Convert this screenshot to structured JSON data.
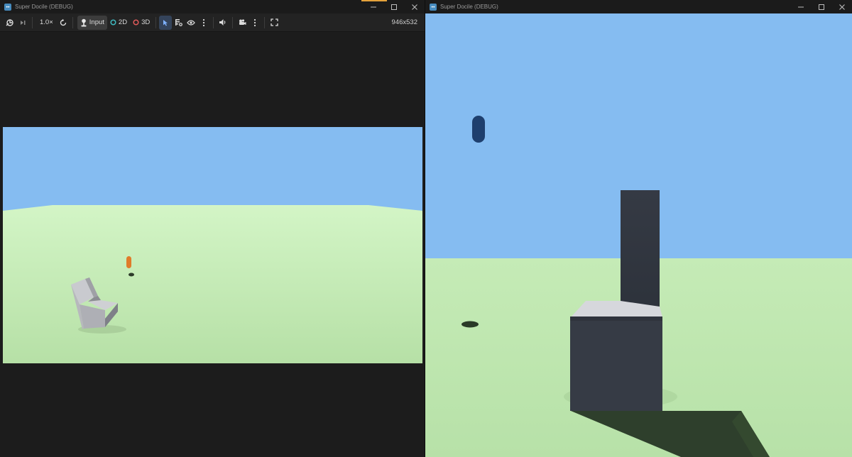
{
  "left_window": {
    "title": "Super Docile (DEBUG)",
    "toolbar": {
      "speed": "1.0×",
      "input_label": "Input",
      "mode_2d": "2D",
      "mode_3d": "3D",
      "resolution": "946x532"
    }
  },
  "right_window": {
    "title": "Super Docile (DEBUG)"
  },
  "colors": {
    "sky": "#85bcf1",
    "ground": "#c3eab6",
    "panel": "#1c1c1c",
    "player_capsule": "#e07b2a",
    "enemy_capsule": "#1e3f6e",
    "dark_block": "#363b45",
    "gray_block": "#b7b8bd",
    "accent": "#478cbf",
    "icon_2d": "#3fb9bf",
    "icon_3d": "#e05a5a"
  },
  "icons": [
    "godot-icon",
    "minimize-icon",
    "maximize-icon",
    "close-icon",
    "embed-icon",
    "next-frame-icon",
    "reset-speed-icon",
    "input-joystick-icon",
    "2d-circle-icon",
    "3d-circle-icon",
    "select-arrow-icon",
    "list-icon",
    "eye-icon",
    "audio-icon",
    "camera-icon",
    "more-icon",
    "fullscreen-icon"
  ]
}
